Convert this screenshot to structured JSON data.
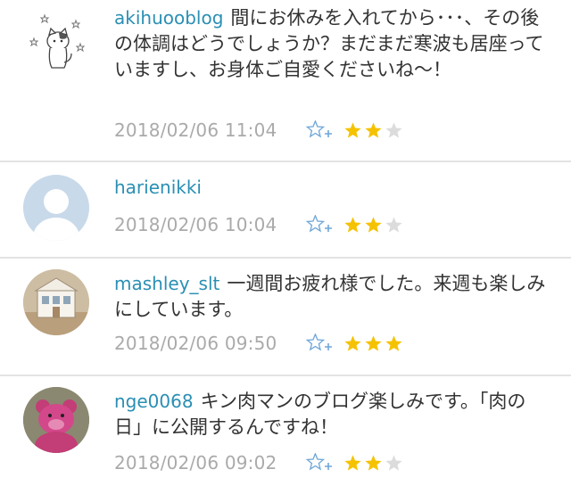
{
  "comments": [
    {
      "username": "akihuooblog",
      "text": "間にお休みを入れてから･･･、その後の体調はどうでしょうか？まだまだ寒波も居座っていますし、お身体ご自愛くださいね～！",
      "timestamp": "2018/02/06 11:04",
      "stars": 2,
      "avatar": "cat-illustration"
    },
    {
      "username": "harienikki",
      "text": "",
      "timestamp": "2018/02/06 10:04",
      "stars": 2,
      "avatar": "default-person"
    },
    {
      "username": "mashley_slt",
      "text": "一週間お疲れ様でした。来週も楽しみにしています。",
      "timestamp": "2018/02/06 09:50",
      "stars": 3,
      "avatar": "dollhouse-photo"
    },
    {
      "username": "nge0068",
      "text": "キン肉マンのブログ楽しみです。「肉の日」に公開するんですね！",
      "timestamp": "2018/02/06 09:02",
      "stars": 2,
      "avatar": "pink-bear-toy"
    }
  ],
  "colors": {
    "username": "#2a8fb4",
    "timestamp": "#aaaaaa",
    "star_filled": "#f5c200",
    "star_empty": "#dcdcdc",
    "add_star": "#6fa6d9"
  }
}
